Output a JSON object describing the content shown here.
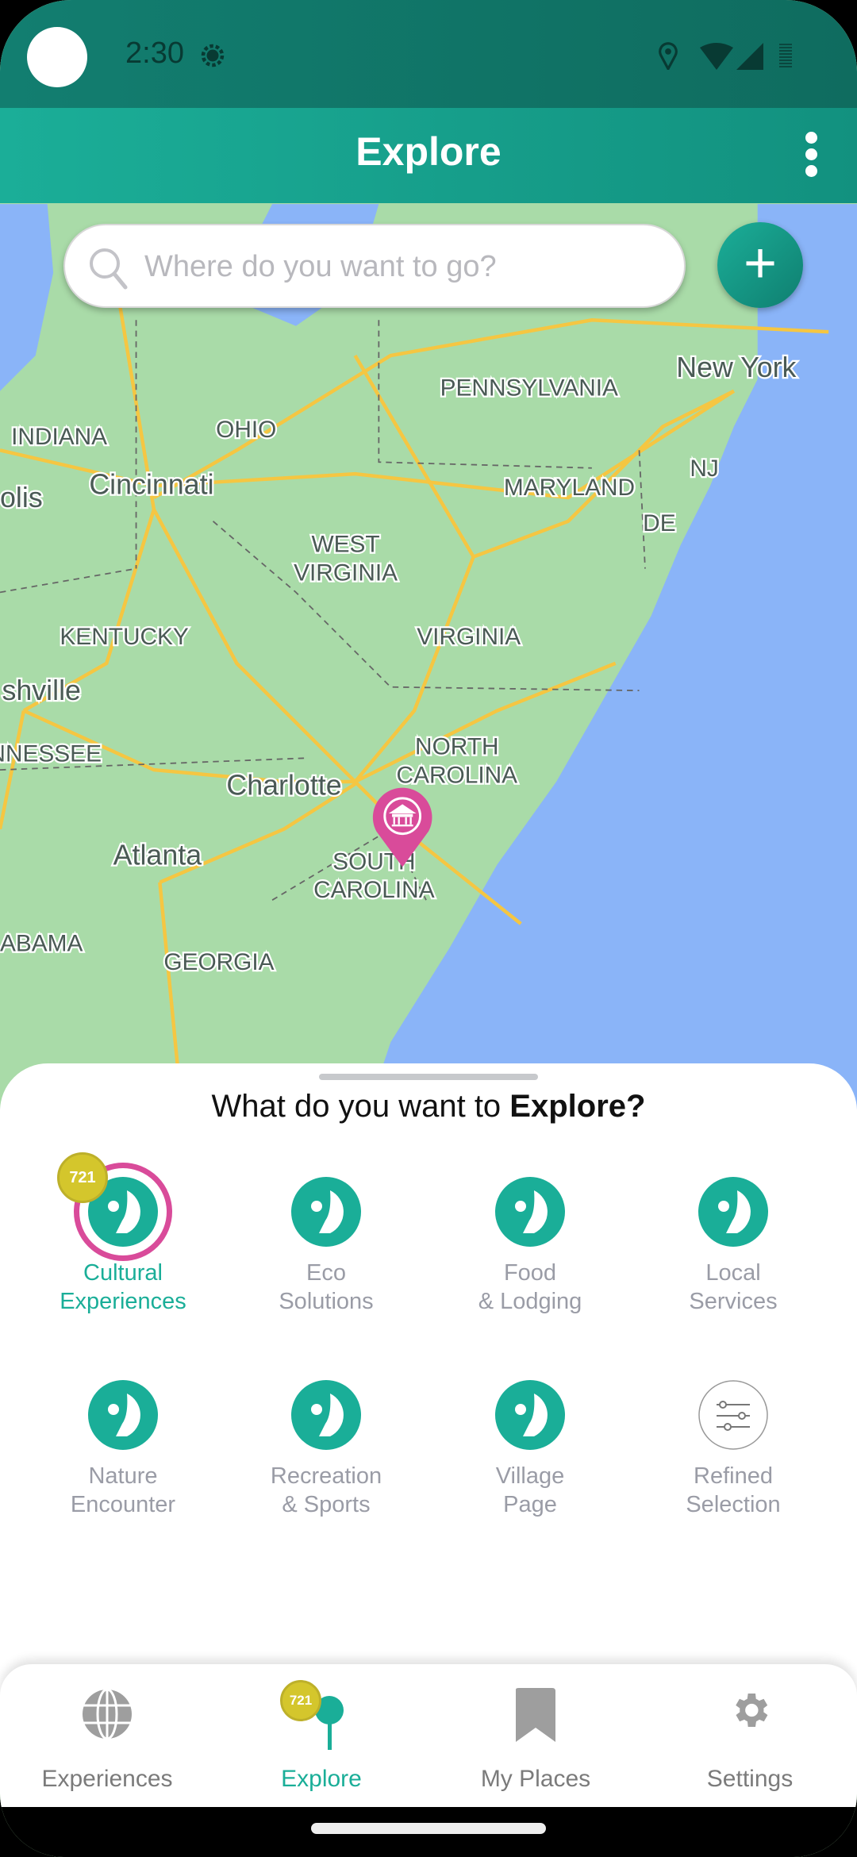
{
  "status_bar": {
    "time": "2:30",
    "icons": [
      "debug-icon",
      "location-icon",
      "wifi-icon",
      "signal-icon",
      "battery-icon"
    ]
  },
  "app_bar": {
    "title": "Explore",
    "menu_icon": "more-vert-icon"
  },
  "search": {
    "placeholder": "Where do you want to go?",
    "value": ""
  },
  "fab": {
    "label": "+"
  },
  "map": {
    "labels": [
      "New York",
      "PENNSYLVANIA",
      "OHIO",
      "INDIANA",
      "Cincinnati",
      "olis",
      "MARYLAND",
      "NJ",
      "DE",
      "WEST",
      "VIRGINIA",
      "KENTUCKY",
      "VIRGINIA",
      "shville",
      "NNESSEE",
      "NORTH",
      "CAROLINA",
      "Charlotte",
      "Atlanta",
      "SOUTH",
      "CAROLINA",
      "ABAMA",
      "GEORGIA"
    ],
    "pin": {
      "icon": "museum-icon",
      "color": "#d94b9a"
    }
  },
  "sheet": {
    "title_prefix": "What do you want to ",
    "title_bold": "Explore?",
    "categories": [
      {
        "line1": "Cultural",
        "line2": "Experiences",
        "active": true,
        "badge": "721"
      },
      {
        "line1": "Eco",
        "line2": "Solutions"
      },
      {
        "line1": "Food",
        "line2": "& Lodging"
      },
      {
        "line1": "Local",
        "line2": "Services"
      },
      {
        "line1": "Nature",
        "line2": "Encounter"
      },
      {
        "line1": "Recreation",
        "line2": "& Sports"
      },
      {
        "line1": "Village",
        "line2": "Page"
      },
      {
        "line1": "Refined",
        "line2": "Selection",
        "icon": "sliders-icon"
      }
    ]
  },
  "bottom_nav": {
    "items": [
      {
        "label": "Experiences",
        "icon": "globe-icon"
      },
      {
        "label": "Explore",
        "icon": "pin-icon",
        "active": true,
        "badge": "721"
      },
      {
        "label": "My Places",
        "icon": "bookmark-icon"
      },
      {
        "label": "Settings",
        "icon": "gear-icon"
      }
    ]
  },
  "colors": {
    "accent": "#1aae98",
    "status_bar": "#127e70",
    "highlight": "#d94b9a",
    "badge": "#d4c62c",
    "inactive_text": "#9a9ca6"
  }
}
